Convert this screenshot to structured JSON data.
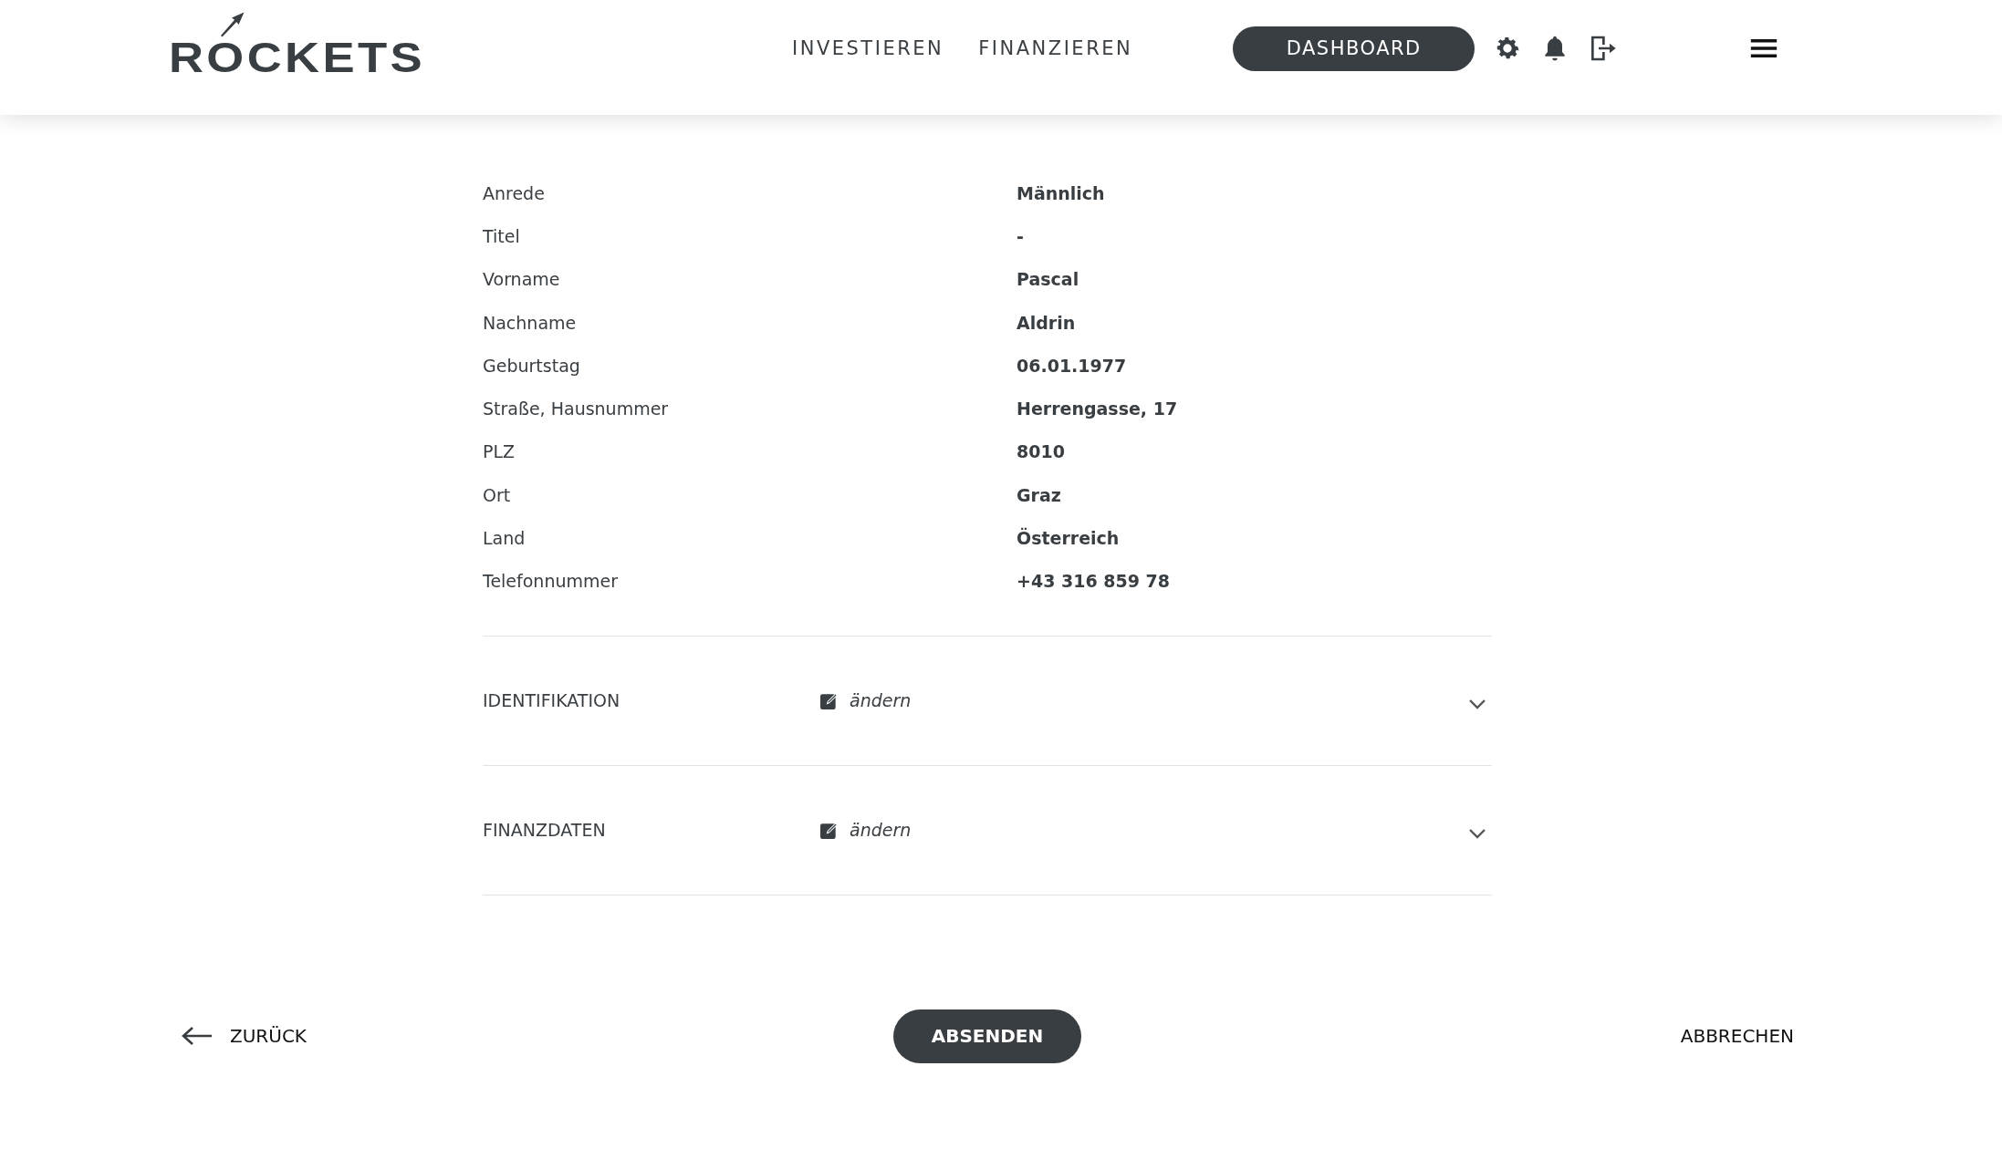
{
  "header": {
    "logo": "ROCKETS",
    "nav": [
      "INVESTIEREN",
      "FINANZIEREN"
    ],
    "dashboard_button": "DASHBOARD"
  },
  "sections": [
    {
      "fields": [
        {
          "label": "Anrede",
          "value": "Männlich"
        },
        {
          "label": "Titel",
          "value": "-"
        },
        {
          "label": "Vorname",
          "value": "Pascal"
        },
        {
          "label": "Nachname",
          "value": "Aldrin"
        },
        {
          "label": "Geburtstag",
          "value": "06.01.1977"
        },
        {
          "label": "Straße, Hausnummer",
          "value": "Herrengasse, 17"
        },
        {
          "label": "PLZ",
          "value": "8010"
        },
        {
          "label": "Ort",
          "value": "Graz"
        },
        {
          "label": "Land",
          "value": "Österreich"
        },
        {
          "label": "Telefonnummer",
          "value": "+43 316 859 78"
        }
      ]
    },
    {
      "title": "IDENTIFIKATION",
      "edit_label": "ändern",
      "expanded": false
    },
    {
      "title": "FINANZDATEN",
      "edit_label": "ändern",
      "expanded": false
    }
  ],
  "footer": {
    "back": "ZURÜCK",
    "submit": "ABSENDEN",
    "cancel": "ABBRECHEN"
  }
}
